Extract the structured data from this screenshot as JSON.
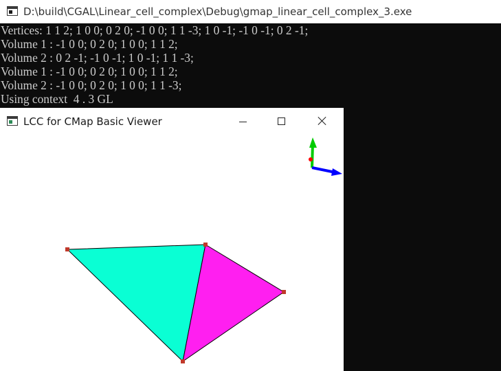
{
  "console": {
    "title": "D:\\build\\CGAL\\Linear_cell_complex\\Debug\\gmap_linear_cell_complex_3.exe",
    "lines": [
      "Vertices: 1 1 2; 1 0 0; 0 2 0; -1 0 0; 1 1 -3; 1 0 -1; -1 0 -1; 0 2 -1;",
      "Volume 1 : -1 0 0; 0 2 0; 1 0 0; 1 1 2;",
      "Volume 2 : 0 2 -1; -1 0 -1; 1 0 -1; 1 1 -3;",
      "Volume 1 : -1 0 0; 0 2 0; 1 0 0; 1 1 2;",
      "Volume 2 : -1 0 0; 0 2 0; 1 0 0; 1 1 -3;",
      "Using context  4 . 3 GL"
    ]
  },
  "viewer": {
    "title": "LCC for CMap Basic Viewer",
    "buttons": {
      "minimize": "minimize",
      "maximize": "maximize",
      "close": "close"
    },
    "colors": {
      "face_left": "#0affd4",
      "face_right": "#ff1ff0",
      "vertex": "#c0392b",
      "axis_x": "#0000ff",
      "axis_y": "#00cc00",
      "axis_z": "#ff0000"
    }
  }
}
